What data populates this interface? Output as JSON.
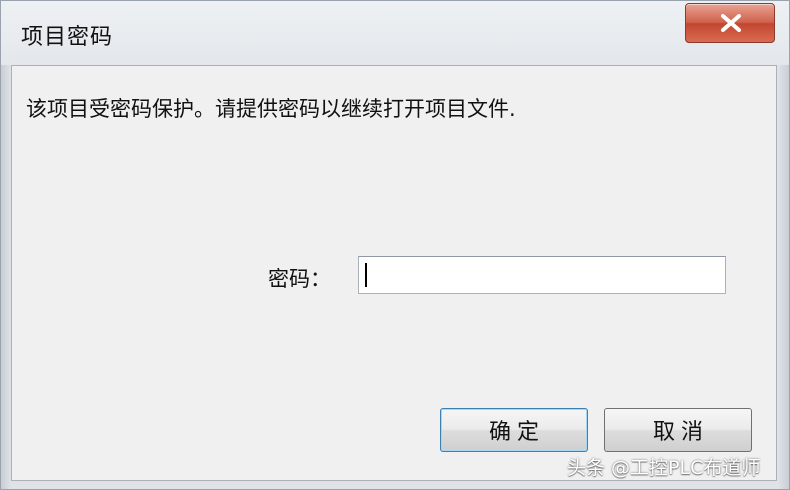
{
  "window": {
    "title": "项目密码",
    "close_icon": "close-x-icon"
  },
  "dialog": {
    "message": "该项目受密码保护。请提供密码以继续打开项目文件.",
    "password_label": "密码：",
    "password_value": ""
  },
  "buttons": {
    "ok_label": "确定",
    "cancel_label": "取消"
  },
  "watermark": {
    "text": "头条 @工控PLC布道师"
  },
  "colors": {
    "close_button": "#d0624c",
    "default_button_border": "#3c7fb1"
  }
}
